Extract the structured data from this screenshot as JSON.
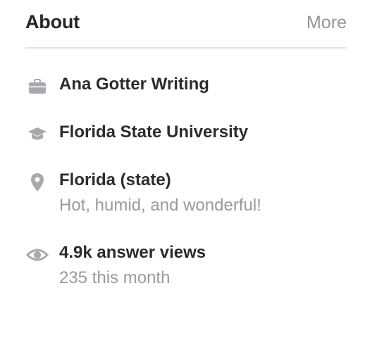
{
  "header": {
    "title": "About",
    "more_label": "More"
  },
  "credentials": [
    {
      "icon": "briefcase-icon",
      "primary": "Ana Gotter Writing"
    },
    {
      "icon": "graduation-cap-icon",
      "primary": "Florida State University"
    },
    {
      "icon": "location-pin-icon",
      "primary": "Florida (state)",
      "secondary": "Hot, humid, and wonderful!"
    },
    {
      "icon": "eye-icon",
      "primary": "4.9k answer views",
      "secondary": "235 this month"
    }
  ],
  "colors": {
    "icon": "#a7a9ac",
    "primary_text": "#2b2b2b",
    "secondary_text": "#9a9a9a",
    "divider": "#e2e2e2"
  }
}
